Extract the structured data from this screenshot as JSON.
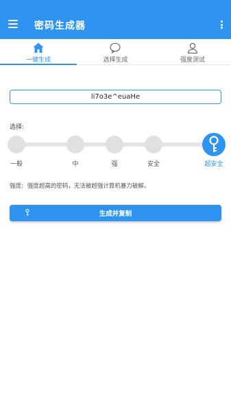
{
  "appbar": {
    "title": "密码生成器",
    "menu_icon": "hamburger-menu-icon",
    "more_icon": "more-vert-icon",
    "color": "#2e94f0"
  },
  "tabs": [
    {
      "label": "一键生成",
      "icon": "home-icon",
      "active": true
    },
    {
      "label": "选择生成",
      "icon": "chat-bubble-icon",
      "active": false
    },
    {
      "label": "强度测试",
      "icon": "person-icon",
      "active": false
    }
  ],
  "password": {
    "value": "li7o3e^euaHe"
  },
  "selector": {
    "label": "选择:",
    "levels": [
      "一般",
      "中",
      "强",
      "安全",
      "超安全"
    ],
    "selected": "超安全",
    "selected_icon": "key-icon"
  },
  "strength": {
    "label": "强度:",
    "description": "强度超高的密码，无法被超强计算机暴力破解。"
  },
  "generate_button": {
    "label": "生成并复制",
    "icon": "key-icon"
  }
}
